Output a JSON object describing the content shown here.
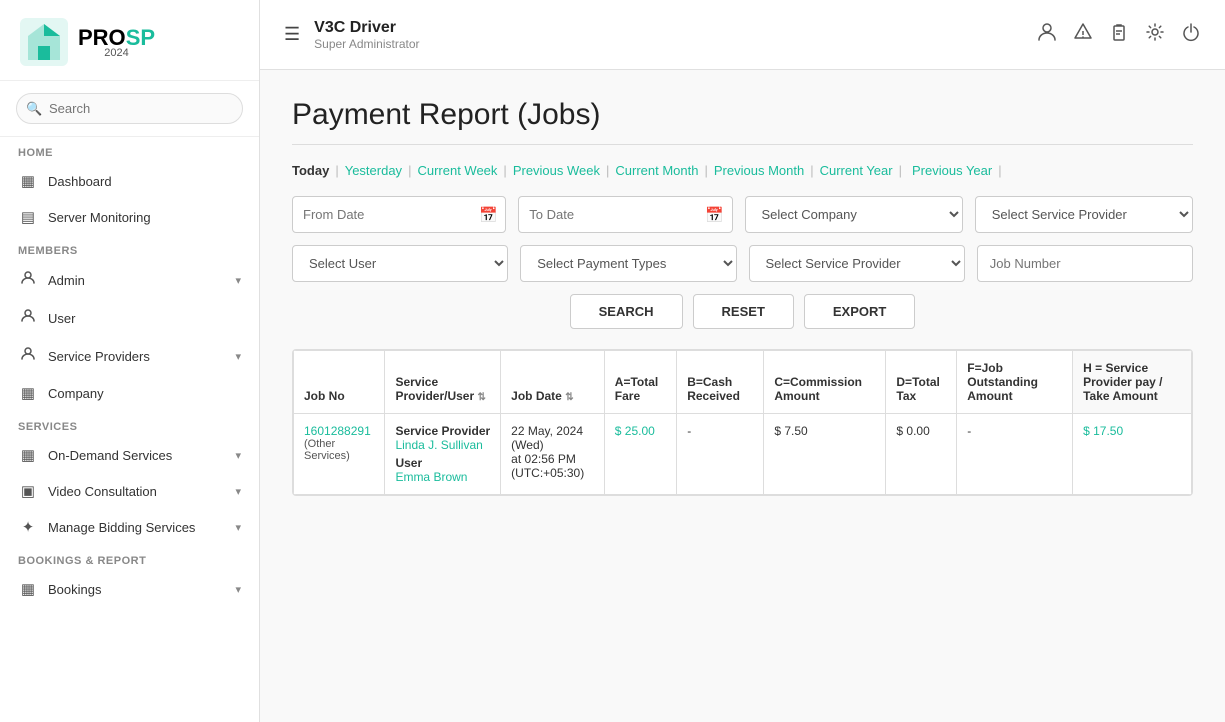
{
  "app": {
    "logo_pro": "PRO",
    "logo_sp": "SP",
    "logo_year": "2024"
  },
  "sidebar": {
    "search_placeholder": "Search",
    "sections": [
      {
        "label": "HOME",
        "items": [
          {
            "id": "dashboard",
            "label": "Dashboard",
            "icon": "▦",
            "arrow": false
          },
          {
            "id": "server-monitoring",
            "label": "Server Monitoring",
            "icon": "▤",
            "arrow": false
          }
        ]
      },
      {
        "label": "MEMBERS",
        "items": [
          {
            "id": "admin",
            "label": "Admin",
            "icon": "👤",
            "arrow": true
          },
          {
            "id": "user",
            "label": "User",
            "icon": "👥",
            "arrow": false
          },
          {
            "id": "service-providers",
            "label": "Service Providers",
            "icon": "👤",
            "arrow": true
          },
          {
            "id": "company",
            "label": "Company",
            "icon": "▦",
            "arrow": false
          }
        ]
      },
      {
        "label": "SERVICES",
        "items": [
          {
            "id": "on-demand-services",
            "label": "On-Demand Services",
            "icon": "▦",
            "arrow": true
          },
          {
            "id": "video-consultation",
            "label": "Video Consultation",
            "icon": "▣",
            "arrow": true
          },
          {
            "id": "manage-bidding",
            "label": "Manage Bidding Services",
            "icon": "✦",
            "arrow": true
          }
        ]
      },
      {
        "label": "BOOKINGS & REPORT",
        "items": [
          {
            "id": "bookings",
            "label": "Bookings",
            "icon": "▦",
            "arrow": true
          }
        ]
      }
    ]
  },
  "topbar": {
    "menu_icon": "☰",
    "title": "V3C Driver",
    "subtitle": "Super Administrator"
  },
  "page": {
    "title": "Payment Report (Jobs)"
  },
  "filter_links": [
    {
      "id": "today",
      "label": "Today",
      "active": true
    },
    {
      "id": "yesterday",
      "label": "Yesterday"
    },
    {
      "id": "current-week",
      "label": "Current Week"
    },
    {
      "id": "previous-week",
      "label": "Previous Week"
    },
    {
      "id": "current-month",
      "label": "Current Month"
    },
    {
      "id": "previous-month",
      "label": "Previous Month"
    },
    {
      "id": "current-year",
      "label": "Current Year"
    },
    {
      "id": "previous-year",
      "label": "Previous Year"
    }
  ],
  "filters": {
    "from_date_placeholder": "From Date",
    "to_date_placeholder": "To Date",
    "select_company_placeholder": "Select Company",
    "select_service_provider_placeholder": "Select Service Provider",
    "select_user_placeholder": "Select User",
    "select_payment_types_placeholder": "Select Payment Types",
    "select_service_provider2_placeholder": "Select Service Provider",
    "job_number_placeholder": "Job Number"
  },
  "buttons": {
    "search": "SEARCH",
    "reset": "RESET",
    "export": "EXPORT"
  },
  "table": {
    "columns": [
      {
        "id": "job-no",
        "label": "Job No"
      },
      {
        "id": "sp-user",
        "label": "Service Provider/User",
        "sort": true
      },
      {
        "id": "job-date",
        "label": "Job Date",
        "sort": true
      },
      {
        "id": "total-fare",
        "label": "A=Total Fare"
      },
      {
        "id": "cash-received",
        "label": "B=Cash Received"
      },
      {
        "id": "commission-amount",
        "label": "C=Commission Amount"
      },
      {
        "id": "total-tax",
        "label": "D=Total Tax"
      },
      {
        "id": "job-outstanding",
        "label": "F=Job Outstanding Amount"
      },
      {
        "id": "sp-pay-take",
        "label": "H = Service Provider pay / Take Amount"
      }
    ],
    "rows": [
      {
        "job_no": "1601288291",
        "job_no_sub": "(Other Services)",
        "sp_label": "Service Provider",
        "sp_name": "Linda J. Sullivan",
        "user_label": "User",
        "user_name": "Emma Brown",
        "job_date": "22 May, 2024 (Wed)",
        "job_time": "at 02:56 PM",
        "job_tz": "(UTC:+05:30)",
        "total_fare": "$ 25.00",
        "total_fare_link": true,
        "cash_received": "-",
        "commission_amount": "$ 7.50",
        "total_tax": "$ 0.00",
        "job_outstanding": "-",
        "sp_pay_take": "$ 17.50",
        "sp_pay_take_link": true
      }
    ]
  }
}
